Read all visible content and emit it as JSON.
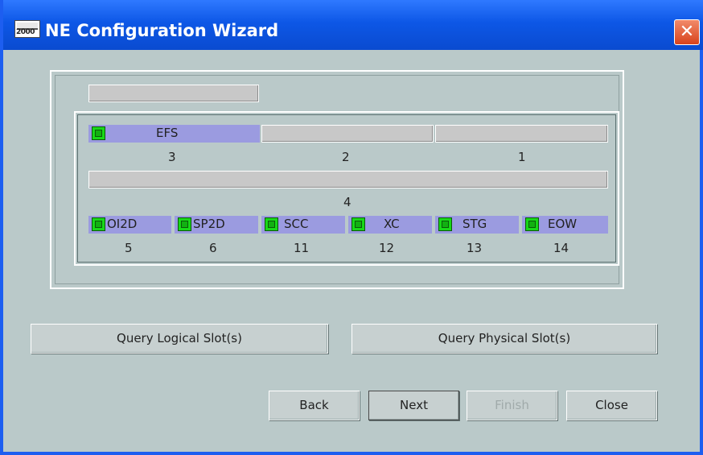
{
  "window": {
    "title": "NE Configuration Wizard",
    "app_icon_text": "2000",
    "close_glyph": "✕",
    "colors": {
      "titlebar": "#0d57e6",
      "background": "#bac9c9",
      "filled_slot": "#9b9be0",
      "led": "#18d818",
      "close": "#d8431c"
    }
  },
  "slots": {
    "row1": [
      {
        "label": "EFS",
        "number": "3",
        "filled": true
      },
      {
        "label": "",
        "number": "2",
        "filled": false
      },
      {
        "label": "",
        "number": "1",
        "filled": false
      }
    ],
    "row2": [
      {
        "label": "",
        "number": "4",
        "filled": false
      }
    ],
    "row3": [
      {
        "label": "OI2D",
        "number": "5",
        "filled": true
      },
      {
        "label": "SP2D",
        "number": "6",
        "filled": true
      },
      {
        "label": "SCC",
        "number": "11",
        "filled": true
      },
      {
        "label": "XC",
        "number": "12",
        "filled": true
      },
      {
        "label": "STG",
        "number": "13",
        "filled": true
      },
      {
        "label": "EOW",
        "number": "14",
        "filled": true
      }
    ]
  },
  "buttons": {
    "query_logical": "Query Logical Slot(s)",
    "query_physical": "Query Physical Slot(s)",
    "back": "Back",
    "next": "Next",
    "finish": "Finish",
    "close": "Close"
  }
}
